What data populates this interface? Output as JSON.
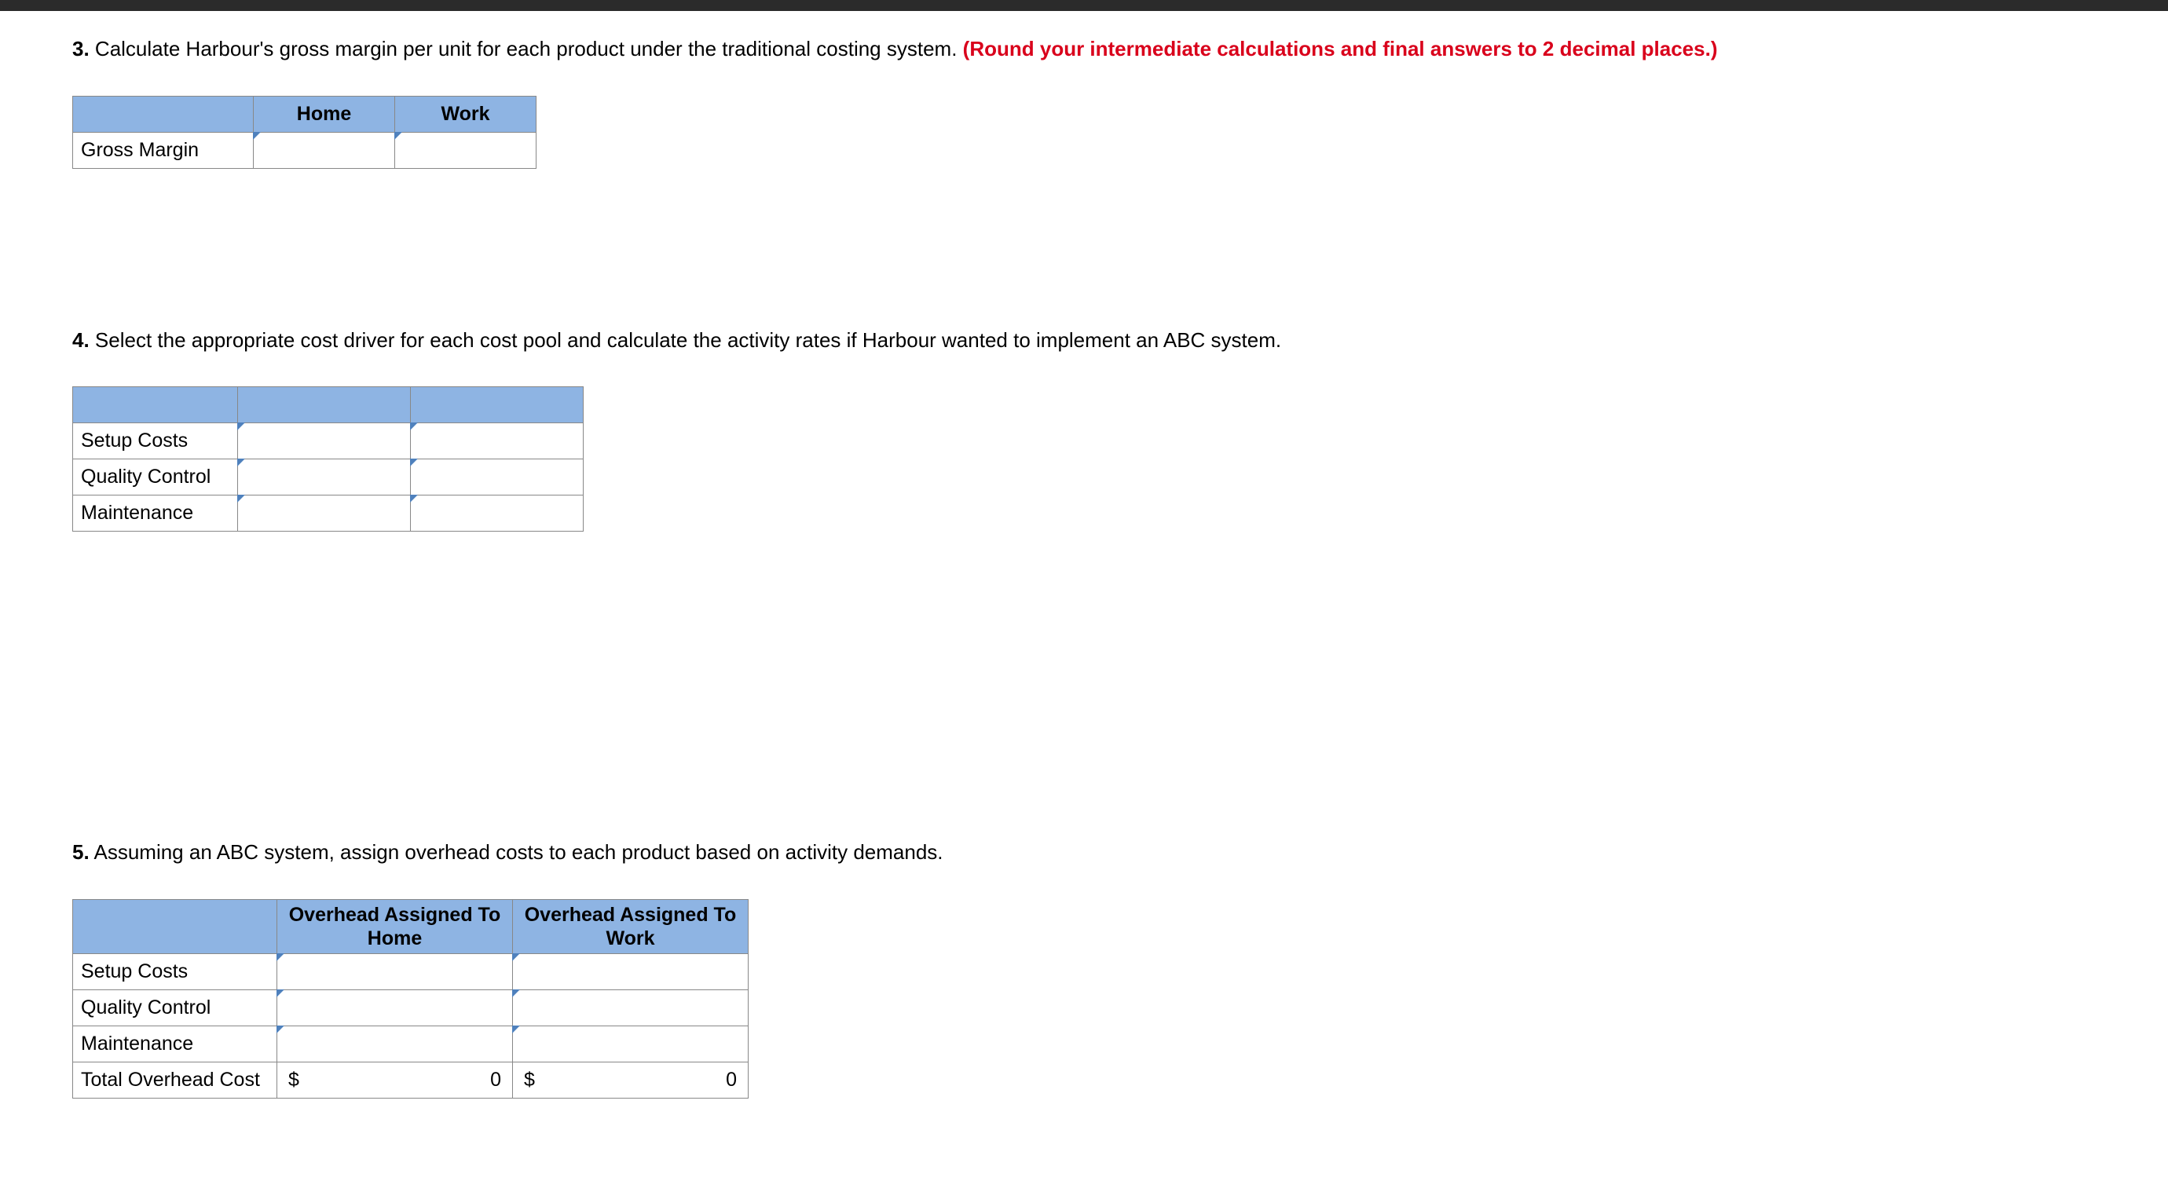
{
  "q3": {
    "num": "3.",
    "text": "Calculate Harbour's gross margin per unit for each product under the traditional costing system.",
    "red": "(Round your intermediate calculations and final answers to 2 decimal places.)",
    "table": {
      "col1": "Home",
      "col2": "Work",
      "row1": "Gross Margin"
    }
  },
  "q4": {
    "num": "4.",
    "text": "Select the appropriate cost driver for each cost pool and calculate the activity rates if Harbour wanted to implement an ABC system.",
    "table": {
      "row1": "Setup Costs",
      "row2": "Quality Control",
      "row3": "Maintenance"
    }
  },
  "q5": {
    "num": "5.",
    "text": "Assuming an ABC system, assign overhead costs to each product based on activity demands.",
    "table": {
      "col1": "Overhead Assigned To Home",
      "col2": "Overhead Assigned To Work",
      "row1": "Setup Costs",
      "row2": "Quality Control",
      "row3": "Maintenance",
      "row4": "Total Overhead Cost",
      "currency": "$",
      "totalHome": "0",
      "totalWork": "0"
    }
  }
}
